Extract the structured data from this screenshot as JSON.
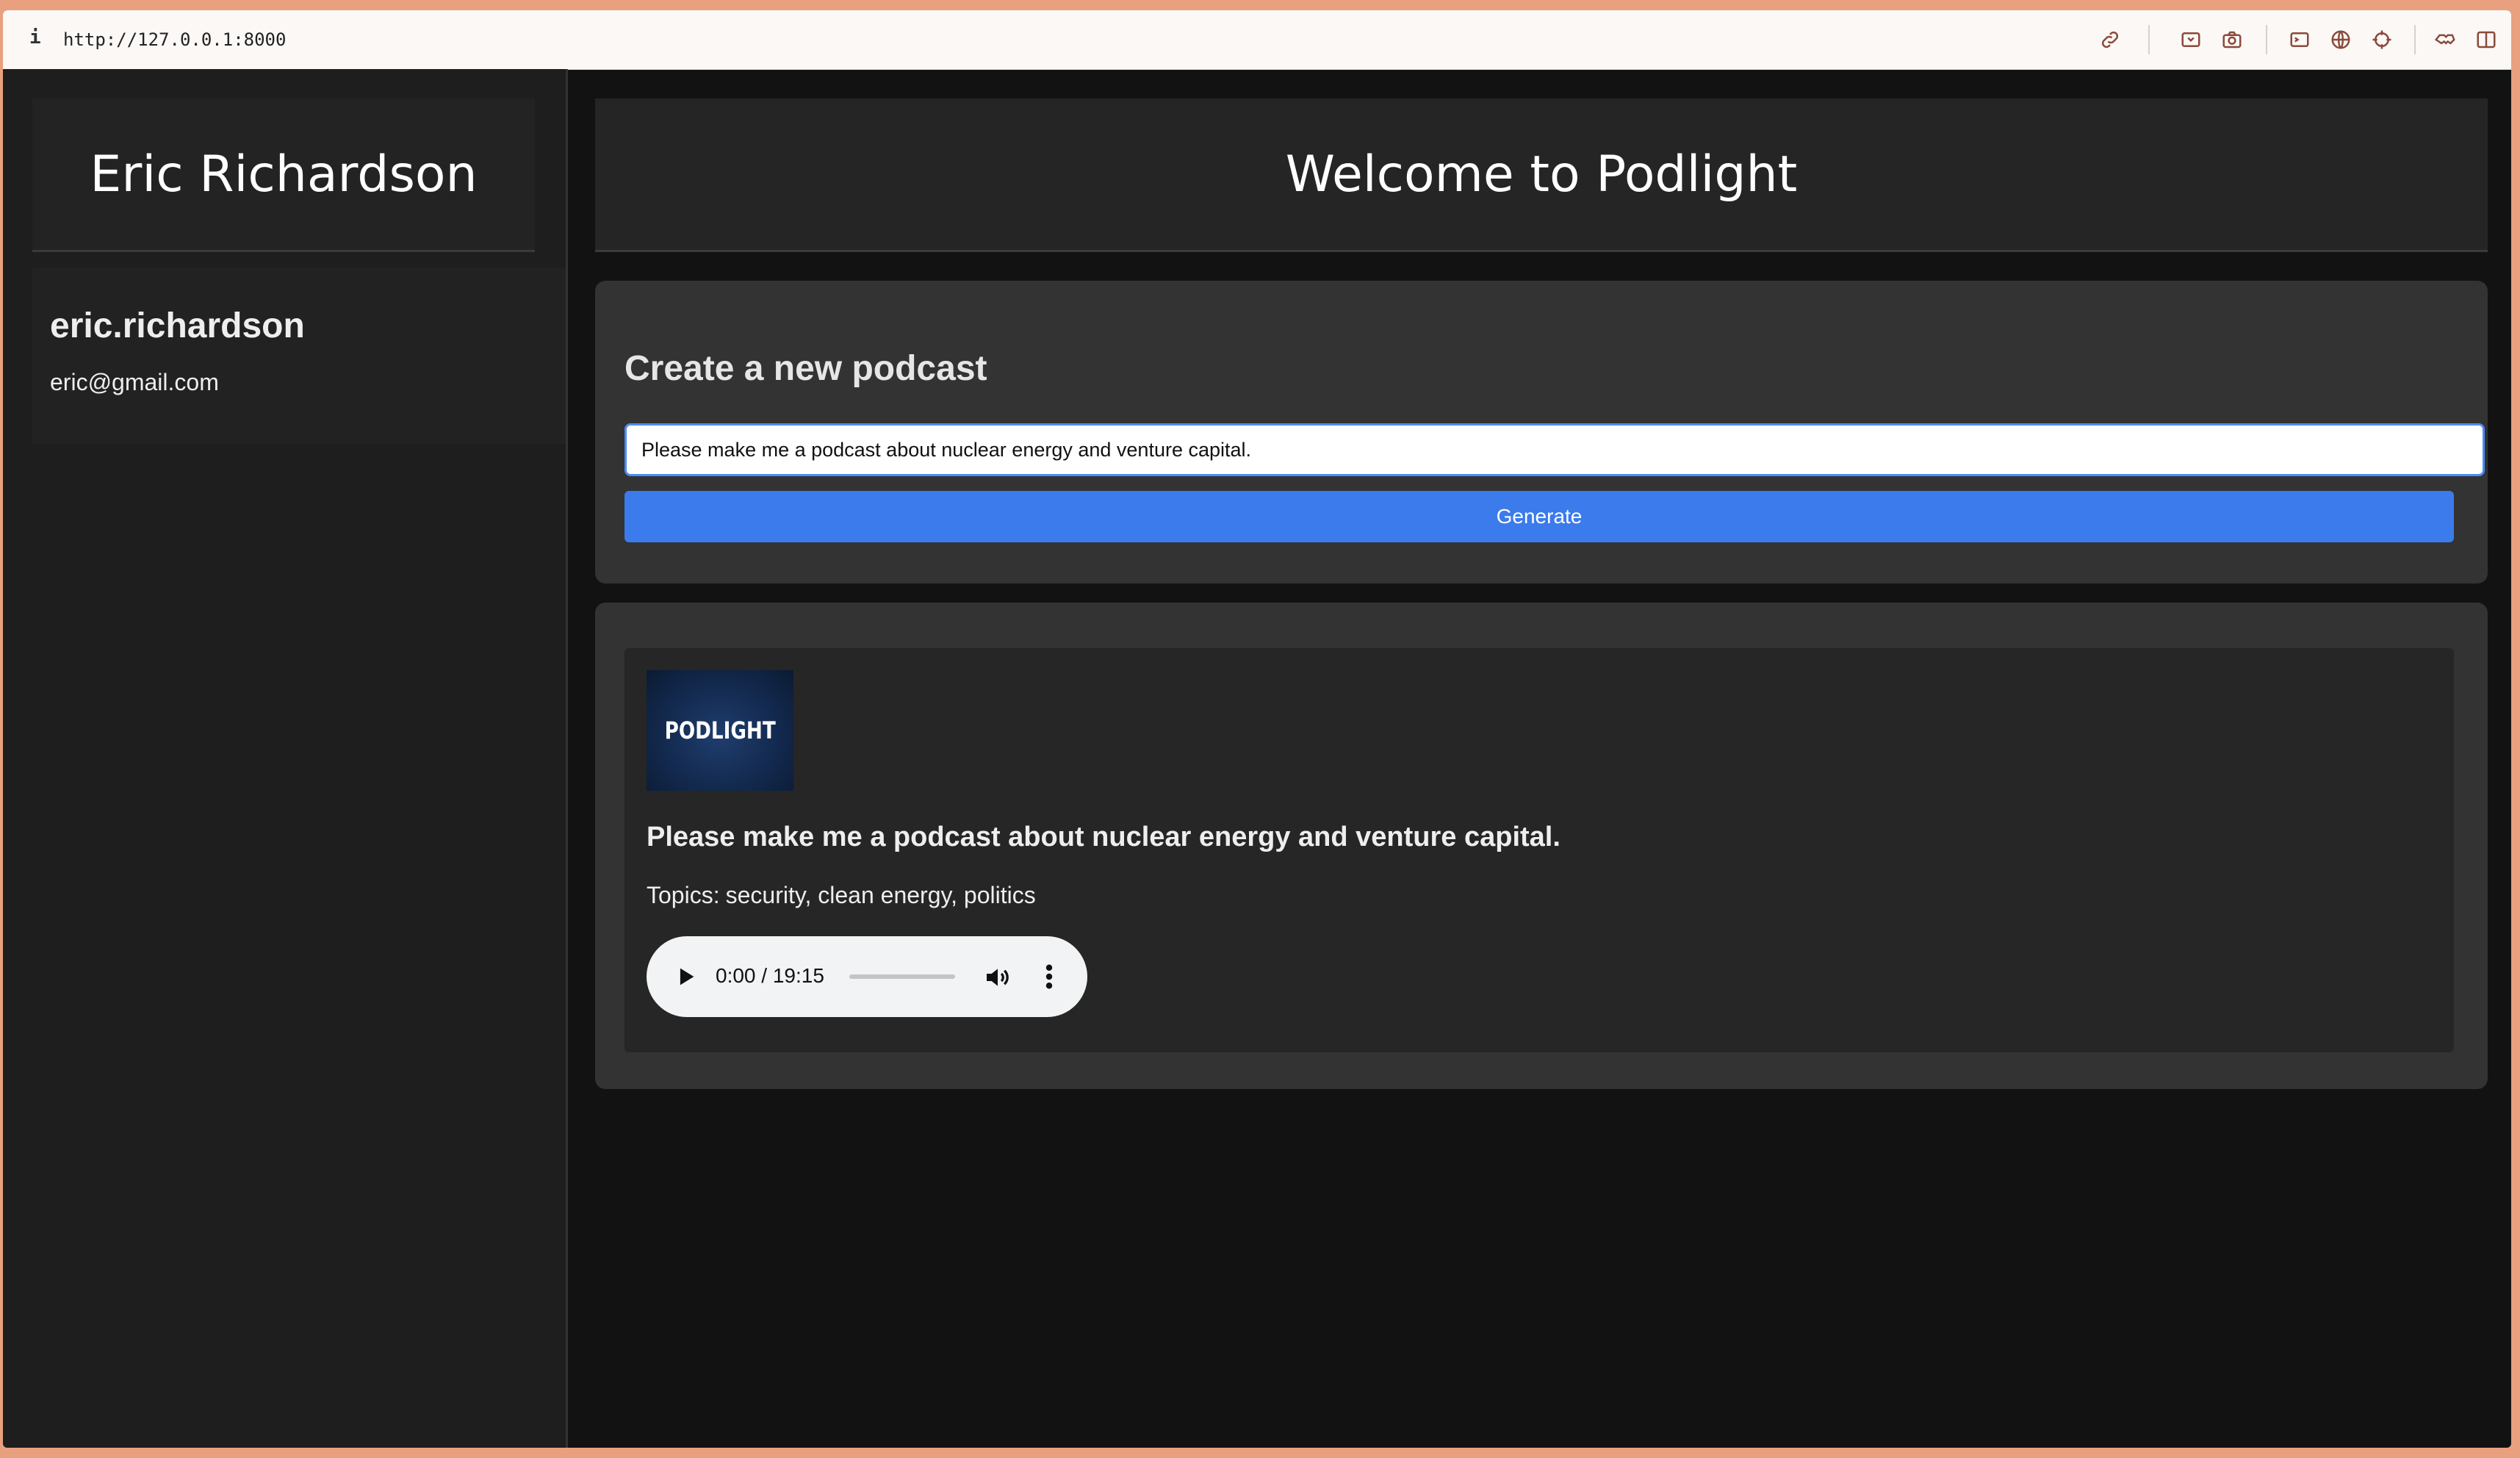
{
  "browser": {
    "info_glyph": "i",
    "url": "http://127.0.0.1:8000",
    "toolbar_icons": [
      "link-icon",
      "inspect-icon",
      "camera-icon",
      "terminal-icon",
      "globe-icon",
      "crosshair-icon",
      "extensions-icon",
      "sidebar-icon"
    ]
  },
  "sidebar": {
    "full_name": "Eric Richardson",
    "username": "eric.richardson",
    "email": "eric@gmail.com"
  },
  "header": {
    "title": "Welcome to Podlight"
  },
  "create": {
    "heading": "Create a new podcast",
    "input_value": "Please make me a podcast about nuclear energy and venture capital.",
    "button_label": "Generate"
  },
  "podcasts": [
    {
      "cover_text": "PODLIGHT",
      "title": "Please make me a podcast about nuclear energy and venture capital.",
      "topics_label": "Topics:",
      "topics": "security, clean energy, politics",
      "player": {
        "time": "0:00 / 19:15"
      }
    }
  ],
  "colors": {
    "accent": "#3b7bec",
    "background": "#121212",
    "card": "#333333",
    "window_border": "#e9a07e"
  }
}
